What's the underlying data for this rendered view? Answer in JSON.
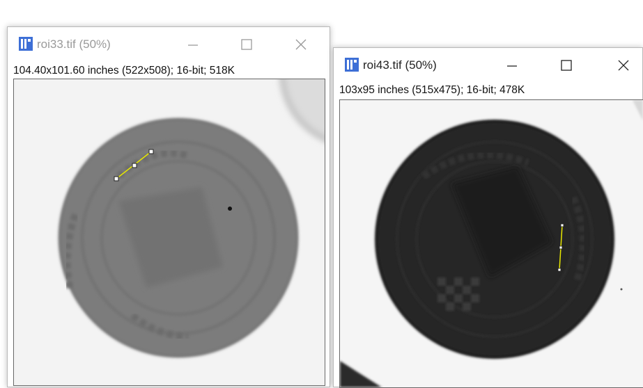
{
  "windows": [
    {
      "title": "roi33.tif (50%)",
      "info": "104.40x101.60 inches (522x508); 16-bit; 518K",
      "disc_color": "#7a7a7a",
      "controls": [
        "minimize-icon",
        "maximize-icon",
        "close-icon"
      ]
    },
    {
      "title": "roi43.tif (50%)",
      "info": "103x95 inches (515x475); 16-bit; 478K",
      "disc_color": "#232323",
      "controls": [
        "minimize-icon",
        "maximize-icon",
        "close-icon"
      ]
    }
  ],
  "colors": {
    "roi_line": "#e8e800",
    "icon_blue": "#3d6fd6",
    "image_background": "#f4f4f4"
  },
  "image_text": {
    "roi33_top": "HNSNA",
    "roi33_left": "INSTRUM",
    "roi33_bottom": "SIZINE",
    "roi43_top": "HARSTSKI UCENIK",
    "roi43_right": "HARNSKI"
  }
}
